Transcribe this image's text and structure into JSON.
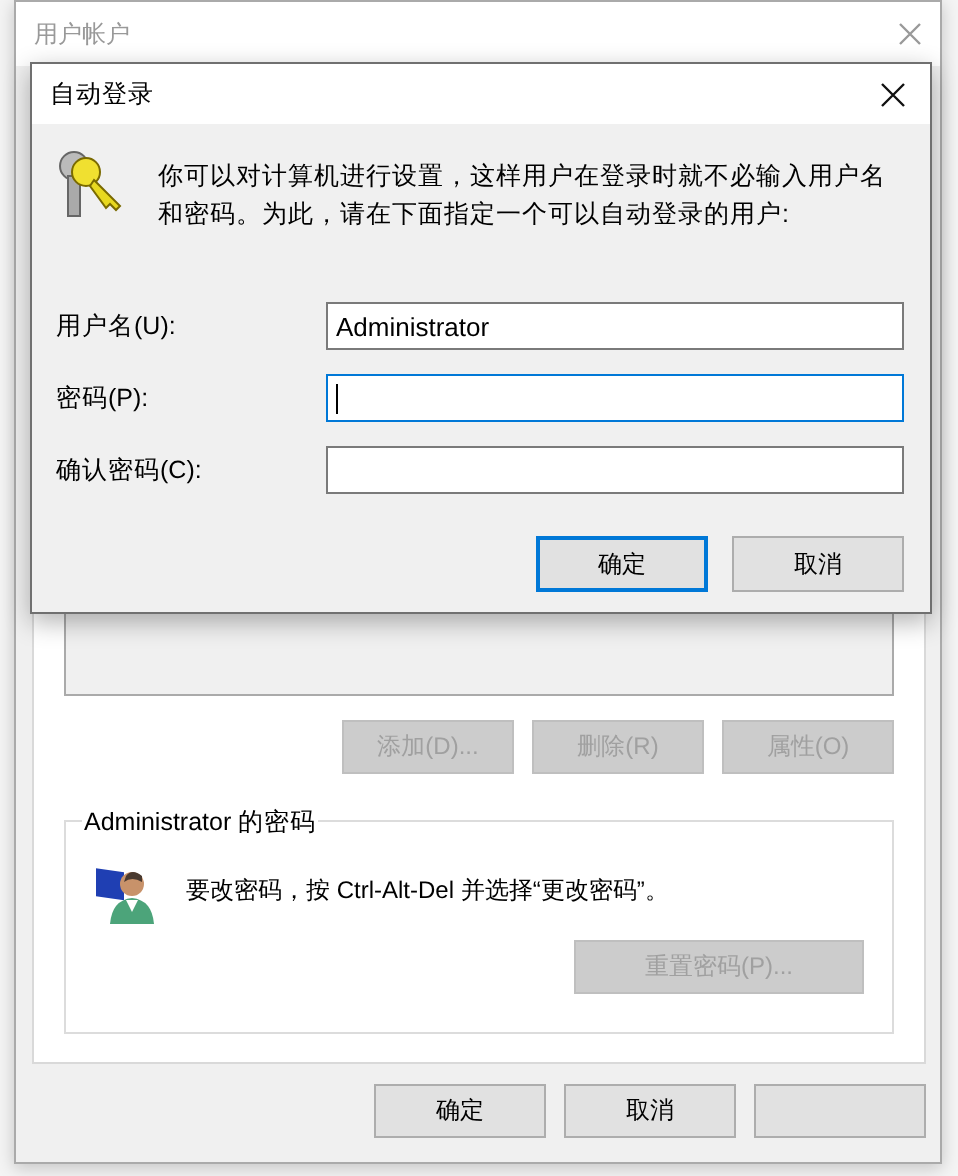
{
  "back_window": {
    "title": "用户帐户",
    "list_buttons": [
      {
        "label": "添加(D)...",
        "disabled": true
      },
      {
        "label": "删除(R)",
        "disabled": true
      },
      {
        "label": "属性(O)",
        "disabled": true
      }
    ],
    "password_group": {
      "title": "Administrator 的密码",
      "message": "要改密码，按 Ctrl-Alt-Del 并选择“更改密码”。",
      "reset_button": {
        "label": "重置密码(P)...",
        "disabled": true
      }
    },
    "buttons": [
      {
        "label": "确定"
      },
      {
        "label": "取消"
      }
    ]
  },
  "dialog": {
    "title": "自动登录",
    "message": "你可以对计算机进行设置，这样用户在登录时就不必输入用户名和密码。为此，请在下面指定一个可以自动登录的用户:",
    "fields": [
      {
        "label": "用户名(U):",
        "value": "Administrator",
        "focused": false
      },
      {
        "label": "密码(P):",
        "focused": true
      },
      {
        "label": "确认密码(C):",
        "focused": false
      }
    ],
    "buttons": [
      {
        "label": "确定",
        "default": true
      },
      {
        "label": "取消",
        "default": false
      }
    ]
  }
}
